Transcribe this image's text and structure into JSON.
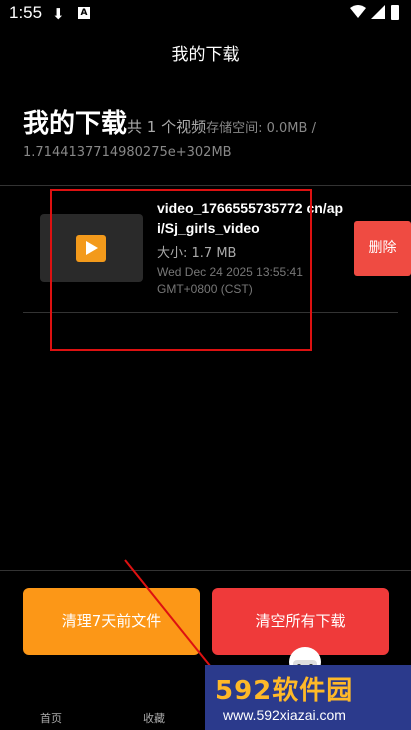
{
  "status_bar": {
    "time": "1:55",
    "download_icon": "download-icon",
    "a_icon": "A"
  },
  "appbar": {
    "title": "我的下载"
  },
  "header": {
    "title": "我的下载",
    "count_text": "共 1 个视频",
    "storage_text": "存储空间: 0.0MB /",
    "storage_total": "1.7144137714980275e+302MB"
  },
  "downloads": [
    {
      "file_name": "video_1766555735772 cn/api/Sj_girls_video",
      "size": "大小: 1.7 MB",
      "date": "Wed Dec 24 2025 13:55:41 GMT+0800 (CST)",
      "delete_label": "删除"
    }
  ],
  "actions": {
    "clean_old": "清理7天前文件",
    "clear_all": "清空所有下载"
  },
  "tabs": [
    {
      "label": "首页"
    },
    {
      "label": "收藏"
    }
  ],
  "watermark": {
    "brand": "592软件园",
    "url": "www.592xiazai.com"
  },
  "colors": {
    "accent_orange": "#fc9717",
    "danger_red": "#ef3a3a",
    "delete_red": "#ef4b42"
  }
}
